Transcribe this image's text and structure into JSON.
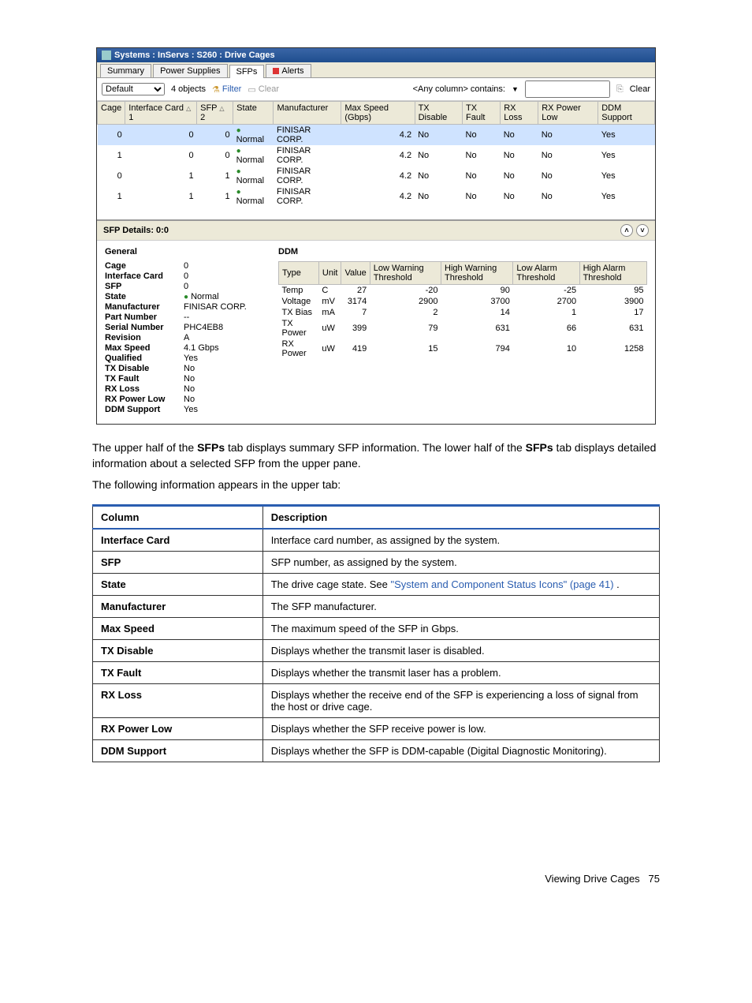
{
  "titlebar": "Systems : InServs : S260 : Drive Cages",
  "tabs": [
    "Summary",
    "Power Supplies",
    "SFPs",
    "Alerts"
  ],
  "active_tab_index": 2,
  "toolbar": {
    "default_label": "Default",
    "object_count": "4 objects",
    "filter_label": "Filter",
    "clear_label": "Clear",
    "contains_label": "<Any column> contains:",
    "clear2_label": "Clear"
  },
  "grid": {
    "headers": [
      "Cage",
      "Interface Card",
      "SFP",
      "State",
      "Manufacturer",
      "Max Speed (Gbps)",
      "TX Disable",
      "TX Fault",
      "RX Loss",
      "RX Power Low",
      "DDM Support"
    ],
    "sort_cols": {
      "1": "1",
      "2": "2"
    },
    "rows": [
      {
        "sel": true,
        "cage": "0",
        "ifc": "0",
        "sfp": "0",
        "state": "Normal",
        "mfr": "FINISAR CORP.",
        "spd": "4.2",
        "txd": "No",
        "txf": "No",
        "rxl": "No",
        "rxp": "No",
        "ddm": "Yes"
      },
      {
        "sel": false,
        "cage": "1",
        "ifc": "0",
        "sfp": "0",
        "state": "Normal",
        "mfr": "FINISAR CORP.",
        "spd": "4.2",
        "txd": "No",
        "txf": "No",
        "rxl": "No",
        "rxp": "No",
        "ddm": "Yes"
      },
      {
        "sel": false,
        "cage": "0",
        "ifc": "1",
        "sfp": "1",
        "state": "Normal",
        "mfr": "FINISAR CORP.",
        "spd": "4.2",
        "txd": "No",
        "txf": "No",
        "rxl": "No",
        "rxp": "No",
        "ddm": "Yes"
      },
      {
        "sel": false,
        "cage": "1",
        "ifc": "1",
        "sfp": "1",
        "state": "Normal",
        "mfr": "FINISAR CORP.",
        "spd": "4.2",
        "txd": "No",
        "txf": "No",
        "rxl": "No",
        "rxp": "No",
        "ddm": "Yes"
      }
    ]
  },
  "details_header": "SFP Details: 0:0",
  "general": {
    "title": "General",
    "items": [
      {
        "k": "Cage",
        "v": "0"
      },
      {
        "k": "Interface Card",
        "v": "0"
      },
      {
        "k": "SFP",
        "v": "0"
      },
      {
        "k": "State",
        "v": "Normal",
        "dot": true
      },
      {
        "k": "Manufacturer",
        "v": "FINISAR CORP."
      },
      {
        "k": "Part Number",
        "v": "--"
      },
      {
        "k": "Serial Number",
        "v": "PHC4EB8"
      },
      {
        "k": "Revision",
        "v": "A"
      },
      {
        "k": "Max Speed",
        "v": "4.1 Gbps"
      },
      {
        "k": "Qualified",
        "v": "Yes"
      },
      {
        "k": "TX Disable",
        "v": "No"
      },
      {
        "k": "TX Fault",
        "v": "No"
      },
      {
        "k": "RX Loss",
        "v": "No"
      },
      {
        "k": "RX Power Low",
        "v": "No"
      },
      {
        "k": "DDM Support",
        "v": "Yes"
      }
    ]
  },
  "ddm": {
    "title": "DDM",
    "headers": [
      "Type",
      "Unit",
      "Value",
      "Low Warning Threshold",
      "High Warning Threshold",
      "Low Alarm Threshold",
      "High Alarm Threshold"
    ],
    "rows": [
      {
        "type": "Temp",
        "unit": "C",
        "value": "27",
        "lw": "-20",
        "hw": "90",
        "la": "-25",
        "ha": "95"
      },
      {
        "type": "Voltage",
        "unit": "mV",
        "value": "3174",
        "lw": "2900",
        "hw": "3700",
        "la": "2700",
        "ha": "3900"
      },
      {
        "type": "TX Bias",
        "unit": "mA",
        "value": "7",
        "lw": "2",
        "hw": "14",
        "la": "1",
        "ha": "17"
      },
      {
        "type": "TX Power",
        "unit": "uW",
        "value": "399",
        "lw": "79",
        "hw": "631",
        "la": "66",
        "ha": "631"
      },
      {
        "type": "RX Power",
        "unit": "uW",
        "value": "419",
        "lw": "15",
        "hw": "794",
        "la": "10",
        "ha": "1258"
      }
    ]
  },
  "body_paragraphs": {
    "p1a": "The upper half of the ",
    "p1b": "SFPs",
    "p1c": " tab displays summary SFP information. The lower half of the ",
    "p1d": "SFPs",
    "p1e": " tab displays detailed information about a selected SFP from the upper pane.",
    "p2": "The following information appears in the upper tab:"
  },
  "doc_table": {
    "headers": [
      "Column",
      "Description"
    ],
    "rows": [
      {
        "c": "Interface Card",
        "d": "Interface card number, as assigned by the system."
      },
      {
        "c": "SFP",
        "d": "SFP number, as assigned by the system."
      },
      {
        "c": "State",
        "d_pre": "The drive cage state. See ",
        "d_link": "\"System and Component Status Icons\" (page 41)",
        "d_post": " ."
      },
      {
        "c": "Manufacturer",
        "d": "The SFP manufacturer."
      },
      {
        "c": "Max Speed",
        "d": "The maximum speed of the SFP in Gbps."
      },
      {
        "c": "TX Disable",
        "d": "Displays whether the transmit laser is disabled."
      },
      {
        "c": "TX Fault",
        "d": "Displays whether the transmit laser has a problem."
      },
      {
        "c": "RX Loss",
        "d": "Displays whether the receive end of the SFP is experiencing a loss of signal from the host or drive cage."
      },
      {
        "c": "RX Power Low",
        "d": "Displays whether the SFP receive power is low."
      },
      {
        "c": "DDM Support",
        "d": "Displays whether the SFP is DDM-capable (Digital Diagnostic Monitoring)."
      }
    ]
  },
  "footer": {
    "text": "Viewing Drive Cages",
    "page": "75"
  }
}
